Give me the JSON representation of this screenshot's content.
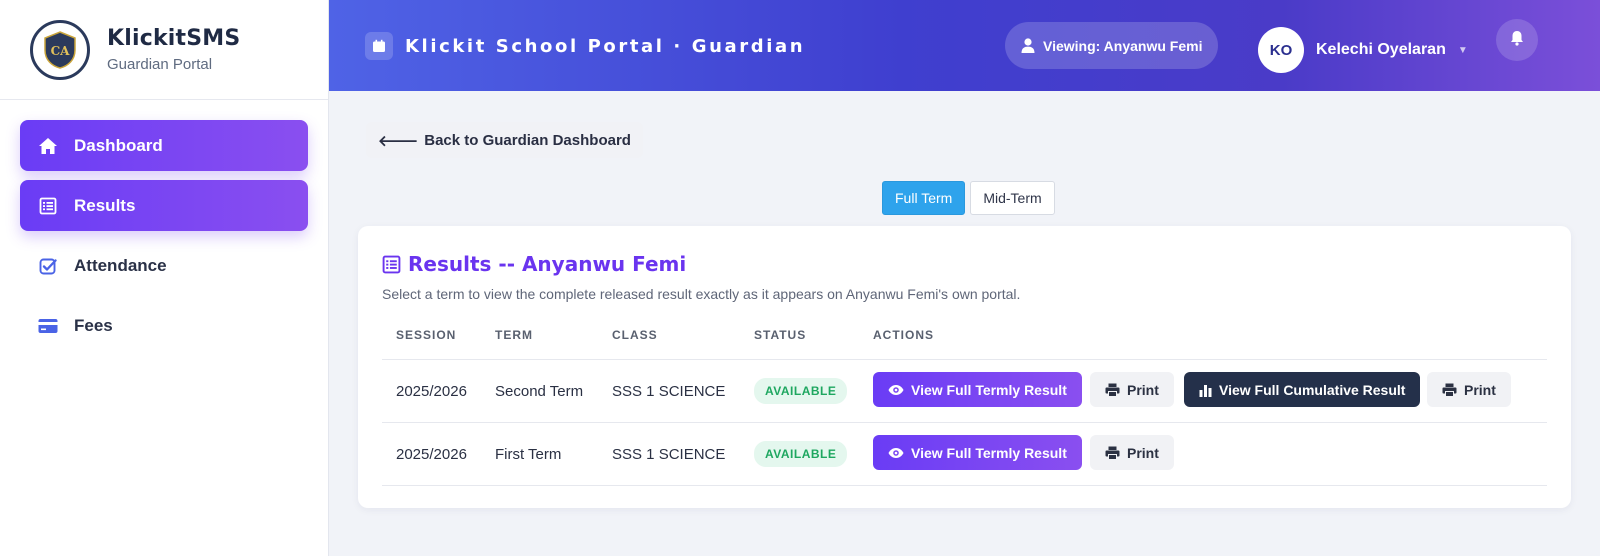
{
  "brand": {
    "name": "KlickitSMS",
    "subtitle": "Guardian Portal",
    "logo_text": "CA"
  },
  "sidebar": {
    "items": [
      {
        "label": "Dashboard",
        "icon": "home-icon",
        "active": true
      },
      {
        "label": "Results",
        "icon": "list-icon",
        "active": true
      },
      {
        "label": "Attendance",
        "icon": "check-square-icon",
        "active": false
      },
      {
        "label": "Fees",
        "icon": "credit-card-icon",
        "active": false
      }
    ]
  },
  "header": {
    "title": "Klickit School Portal · Guardian",
    "viewing": "Viewing: Anyanwu Femi",
    "user_initials": "KO",
    "user_name": "Kelechi Oyelaran"
  },
  "main": {
    "back_label": "Back to Guardian Dashboard",
    "toggle": {
      "full_term": "Full Term",
      "mid_term": "Mid-Term",
      "selected": "Full Term"
    },
    "card": {
      "title": "Results -- Anyanwu Femi",
      "description": "Select a term to view the complete released result exactly as it appears on Anyanwu Femi's own portal.",
      "columns": [
        "SESSION",
        "TERM",
        "CLASS",
        "STATUS",
        "ACTIONS"
      ],
      "rows": [
        {
          "session": "2025/2026",
          "term": "Second Term",
          "class": "SSS 1 SCIENCE",
          "status": "AVAILABLE",
          "actions": {
            "termly": "View Full Termly Result",
            "print1": "Print",
            "cumulative": "View Full Cumulative Result",
            "print2": "Print"
          }
        },
        {
          "session": "2025/2026",
          "term": "First Term",
          "class": "SSS 1 SCIENCE",
          "status": "AVAILABLE",
          "actions": {
            "termly": "View Full Termly Result",
            "print1": "Print"
          }
        }
      ]
    }
  },
  "colors": {
    "accent_purple": "#6a3cf5",
    "header_blue": "#4f63e6",
    "toggle_blue": "#2ea3ec",
    "status_green": "#1ea760",
    "dark_button": "#24304a"
  }
}
